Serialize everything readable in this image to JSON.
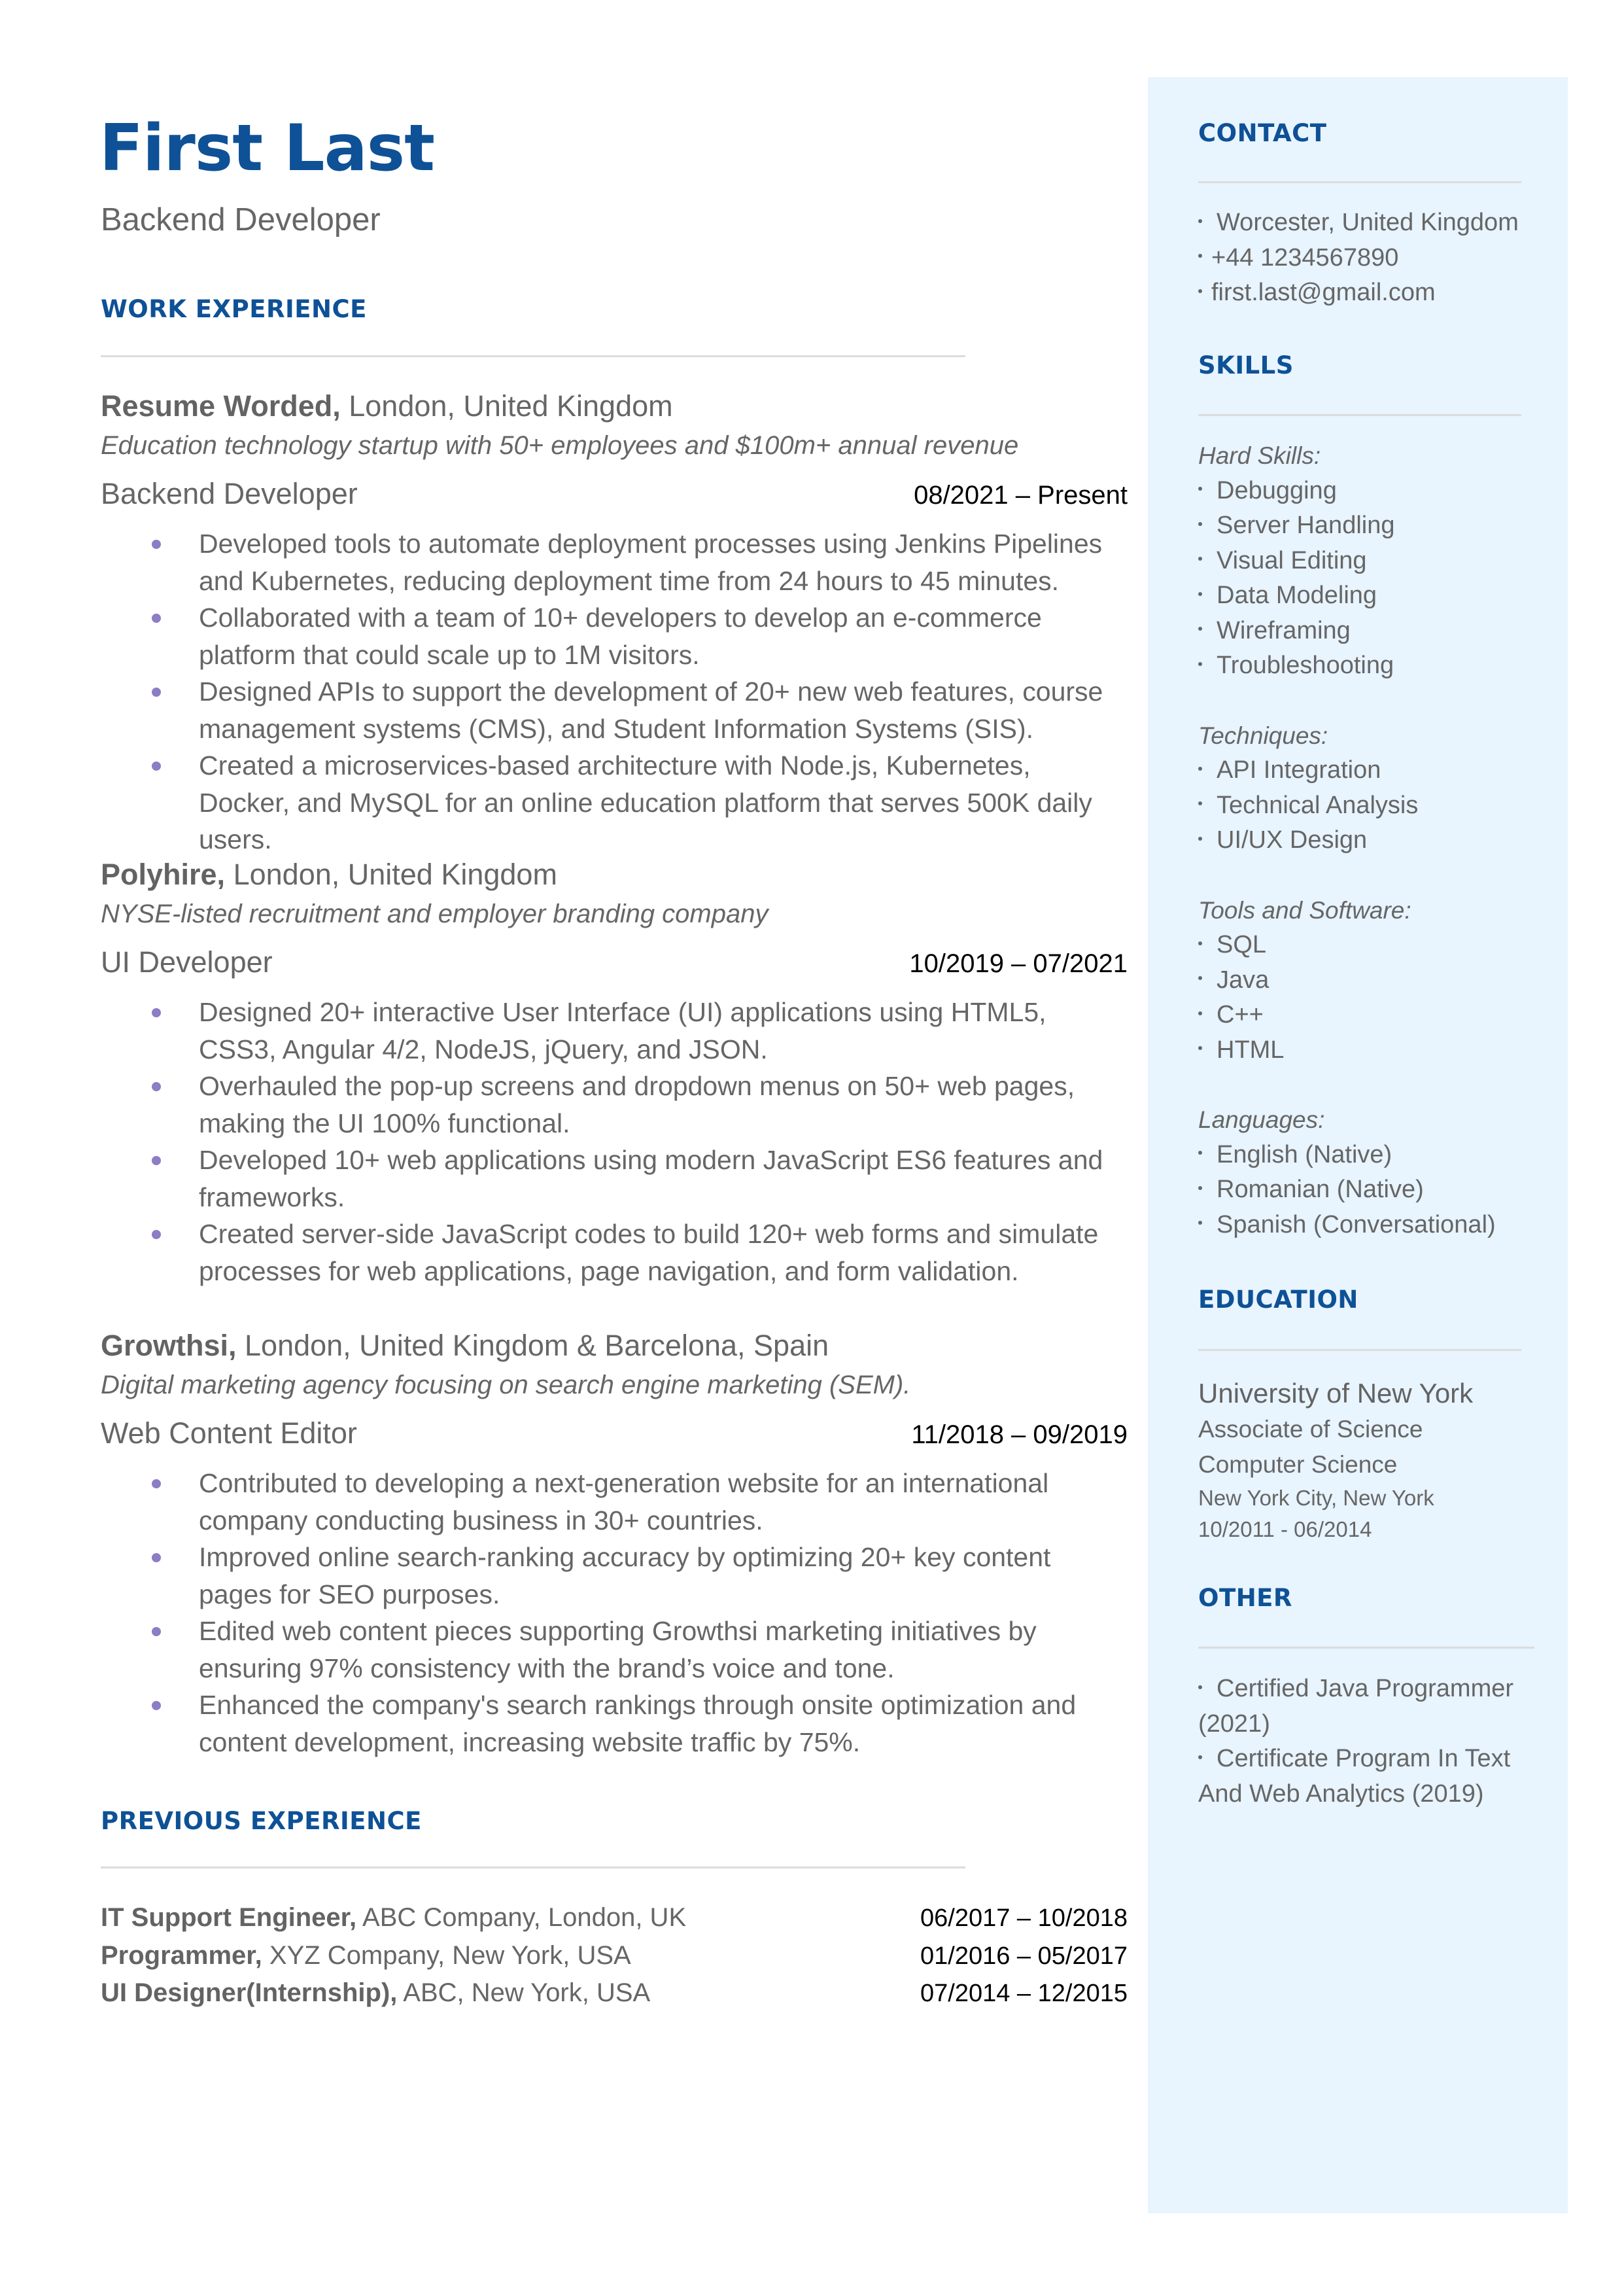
{
  "header": {
    "name": "First Last",
    "title": "Backend Developer"
  },
  "colors": {
    "accent": "#0e5196",
    "sidebar_bg": "#e8f4fe",
    "bullet": "#8c7dc4",
    "text": "#666666"
  },
  "sections": {
    "work_experience": "WORK EXPERIENCE",
    "previous_experience": "PREVIOUS EXPERIENCE",
    "contact": "CONTACT",
    "skills": "SKILLS",
    "education": "EDUCATION",
    "other": "OTHER"
  },
  "jobs": [
    {
      "company": "Resume Worded,",
      "location": " London, United Kingdom",
      "description": "Education technology startup with 50+ employees and $100m+ annual revenue",
      "role": "Backend Developer",
      "dates": "08/2021 – Present",
      "bullets": [
        "Developed tools to automate deployment processes using Jenkins Pipelines and Kubernetes, reducing deployment time from 24 hours to 45 minutes.",
        "Collaborated with a team of 10+ developers to develop an e-commerce platform that could scale up to 1M visitors.",
        "Designed APIs to support the development of 20+ new web features, course management systems (CMS), and Student Information Systems (SIS).",
        "Created a microservices-based architecture with Node.js, Kubernetes, Docker, and MySQL for an online education platform that serves 500K daily users."
      ]
    },
    {
      "company": "Polyhire,",
      "location": " London, United Kingdom",
      "description": "NYSE-listed recruitment and employer branding company",
      "role": "UI Developer",
      "dates": "10/2019 – 07/2021",
      "bullets": [
        "Designed 20+ interactive User Interface (UI) applications using HTML5, CSS3, Angular 4/2, NodeJS, jQuery, and JSON.",
        "Overhauled the pop-up screens and dropdown menus on 50+ web pages, making the UI 100% functional.",
        "Developed 10+ web applications using modern JavaScript ES6 features and frameworks.",
        "Created server-side JavaScript codes to build 120+ web forms and simulate processes for web applications, page navigation, and form validation."
      ]
    },
    {
      "company": "Growthsi,",
      "location": " London, United Kingdom & Barcelona, Spain",
      "description": "Digital marketing agency focusing on search engine marketing (SEM).",
      "role": "Web Content Editor",
      "dates": "11/2018 – 09/2019",
      "bullets": [
        "Contributed to developing a next-generation website for an international company conducting business in 30+ countries.",
        "Improved online search-ranking accuracy by optimizing 20+ key content pages for SEO purposes.",
        "Edited web content pieces supporting Growthsi marketing initiatives by ensuring 97% consistency with the brand’s voice and tone.",
        "Enhanced the company's search rankings through onsite optimization and content development, increasing website traffic by 75%."
      ]
    }
  ],
  "previous": [
    {
      "title": "IT Support Engineer,",
      "detail": " ABC Company, London, UK",
      "dates": "06/2017 – 10/2018"
    },
    {
      "title": "Programmer,",
      "detail": " XYZ Company, New York, USA",
      "dates": "01/2016 – 05/2017"
    },
    {
      "title": "UI Designer(Internship),",
      "detail": " ABC, New York, USA",
      "dates": "07/2014 – 12/2015"
    }
  ],
  "contact": {
    "location": "Worcester, United Kingdom",
    "phone": "+44 1234567890",
    "email": "first.last@gmail.com"
  },
  "skills": {
    "groups": [
      {
        "label": "Hard Skills:",
        "items": [
          "Debugging",
          "Server Handling",
          "Visual Editing",
          "Data Modeling",
          "Wireframing",
          "Troubleshooting"
        ]
      },
      {
        "label": "Techniques:",
        "items": [
          "API Integration",
          "Technical Analysis",
          "UI/UX Design"
        ]
      },
      {
        "label": "Tools and Software:",
        "items": [
          "SQL",
          "Java",
          "C++",
          "HTML"
        ]
      },
      {
        "label": "Languages:",
        "items": [
          "English (Native)",
          "Romanian (Native)",
          "Spanish (Conversational)"
        ]
      }
    ]
  },
  "education": {
    "school": "University of New York",
    "degree": "Associate of Science",
    "field": "Computer Science",
    "location": "New York City, New York",
    "dates": "10/2011 - 06/2014"
  },
  "other": {
    "items": [
      "Certified Java Programmer (2021)",
      "Certificate Program In Text And Web Analytics (2019)"
    ]
  }
}
